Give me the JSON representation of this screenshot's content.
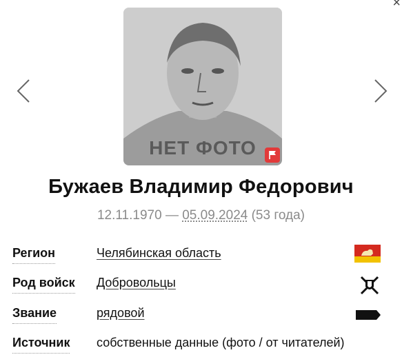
{
  "window": {
    "close_glyph": "×"
  },
  "photo": {
    "placeholder_text": "НЕТ ФОТО"
  },
  "person": {
    "name": "Бужаев Владимир Федорович",
    "birth_date": "12.11.1970",
    "dash": " — ",
    "death_date": "05.09.2024",
    "age": " (53 года)"
  },
  "details": {
    "region": {
      "label": "Регион",
      "value": "Челябинская область",
      "icon": "region-flag-icon"
    },
    "troops": {
      "label": "Род войск",
      "value": "Добровольцы",
      "icon": "crossed-swords-shield-icon"
    },
    "rank": {
      "label": "Звание",
      "value": "рядовой",
      "icon": "rank-epaulette-icon"
    },
    "source": {
      "label": "Источник",
      "value": "собственные данные (фото / от читателей)"
    }
  },
  "colors": {
    "accent_red": "#e23a3a",
    "flag_yellow": "#f2c200",
    "text_gray": "#8a8a8a"
  }
}
